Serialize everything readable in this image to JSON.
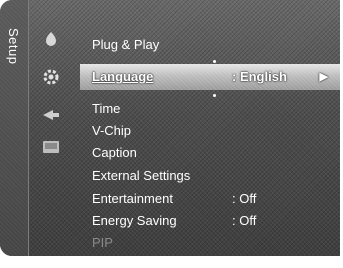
{
  "tab": {
    "label": "Setup"
  },
  "icons": [
    "picture-icon",
    "setup-gear-icon",
    "input-icon",
    "application-icon"
  ],
  "menu": {
    "items": [
      {
        "label": "Plug & Play",
        "value": ""
      },
      {
        "label": "Language",
        "value": ": English"
      },
      {
        "label": "Time",
        "value": ""
      },
      {
        "label": "V-Chip",
        "value": ""
      },
      {
        "label": "Caption",
        "value": ""
      },
      {
        "label": "External Settings",
        "value": ""
      },
      {
        "label": "Entertainment",
        "value": ": Off"
      },
      {
        "label": "Energy Saving",
        "value": ": Off"
      },
      {
        "label": "PIP",
        "value": ""
      }
    ],
    "selected_arrow": "▶"
  },
  "colors": {
    "panel": "#4e4e4e",
    "highlight": "#c8c8c8",
    "text": "#ffffff",
    "disabled_text": "#8a8a8a"
  }
}
